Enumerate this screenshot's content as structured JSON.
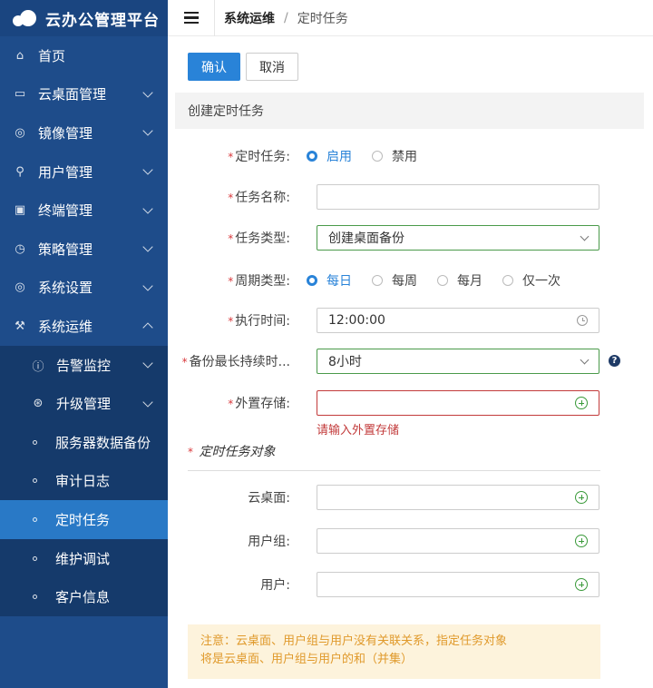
{
  "app": {
    "title": "云办公管理平台"
  },
  "sidebar": {
    "items": [
      {
        "label": "首页",
        "icon": "home-icon",
        "glyph": "⌂",
        "chevron": false
      },
      {
        "label": "云桌面管理",
        "icon": "monitor-icon",
        "glyph": "▭",
        "chevron": true
      },
      {
        "label": "镜像管理",
        "icon": "disc-icon",
        "glyph": "◎",
        "chevron": true
      },
      {
        "label": "用户管理",
        "icon": "user-icon",
        "glyph": "⚲",
        "chevron": true
      },
      {
        "label": "终端管理",
        "icon": "terminal-icon",
        "glyph": "▣",
        "chevron": true
      },
      {
        "label": "策略管理",
        "icon": "clock-icon",
        "glyph": "◷",
        "chevron": true
      },
      {
        "label": "系统设置",
        "icon": "settings-icon",
        "glyph": "◎",
        "chevron": true
      },
      {
        "label": "系统运维",
        "icon": "wrench-icon",
        "glyph": "⚒",
        "chevron": "up"
      }
    ],
    "sub_items": [
      {
        "label": "告警监控",
        "icon": "alert-icon",
        "glyph": "ⓘ",
        "chevron": true
      },
      {
        "label": "升级管理",
        "icon": "upgrade-icon",
        "glyph": "⊛",
        "chevron": true
      },
      {
        "label": "服务器数据备份",
        "bullet": true
      },
      {
        "label": "审计日志",
        "bullet": true
      },
      {
        "label": "定时任务",
        "bullet": true,
        "active": true
      },
      {
        "label": "维护调试",
        "bullet": true
      },
      {
        "label": "客户信息",
        "bullet": true
      }
    ]
  },
  "header": {
    "breadcrumb": [
      "系统运维",
      "定时任务"
    ],
    "separator": "/"
  },
  "toolbar": {
    "confirm_label": "确认",
    "cancel_label": "取消"
  },
  "form": {
    "section_title": "创建定时任务",
    "required_mark": "*",
    "task": {
      "label": "定时任务:",
      "options": [
        "启用",
        "禁用"
      ],
      "selected": "启用"
    },
    "name": {
      "label": "任务名称:",
      "value": ""
    },
    "type": {
      "label": "任务类型:",
      "value": "创建桌面备份"
    },
    "cycle": {
      "label": "周期类型:",
      "options": [
        "每日",
        "每周",
        "每月",
        "仅一次"
      ],
      "selected": "每日"
    },
    "time": {
      "label": "执行时间:",
      "value": "12:00:00"
    },
    "duration": {
      "label": "备份最长持续时...",
      "value": "8小时",
      "help": "?"
    },
    "storage": {
      "label": "外置存储:",
      "value": "",
      "error": "请输入外置存储"
    },
    "objects_title": "定时任务对象",
    "desktop": {
      "label": "云桌面:",
      "value": ""
    },
    "user_group": {
      "label": "用户组:",
      "value": ""
    },
    "user": {
      "label": "用户:",
      "value": ""
    }
  },
  "notice": {
    "line1": "注意：云桌面、用户组与用户没有关联关系，指定任务对象",
    "line2": "将是云桌面、用户组与用户的和（并集）"
  },
  "colors": {
    "sidebar": "#1e4c8a",
    "active": "#2979c6",
    "primary": "#2983d8",
    "error": "#c23a3a",
    "notice_bg": "#fdf3dc",
    "notice_text": "#e09a2c"
  }
}
